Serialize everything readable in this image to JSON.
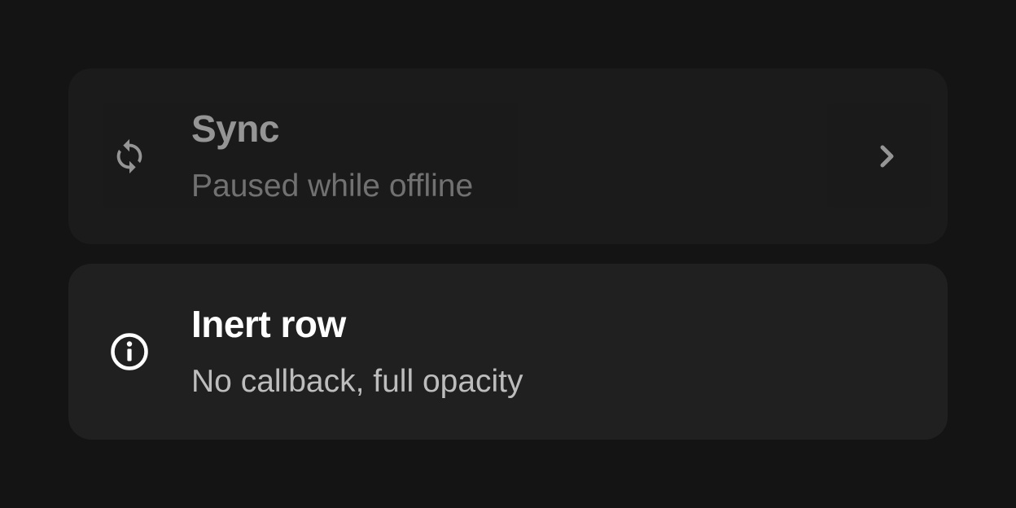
{
  "rows": [
    {
      "title": "Sync",
      "subtitle": "Paused while offline",
      "icon": "sync-icon",
      "trailing": "chevron-right-icon",
      "disabled": true
    },
    {
      "title": "Inert row",
      "subtitle": "No callback, full opacity",
      "icon": "info-icon",
      "disabled": false
    }
  ],
  "colors": {
    "background": "#141414",
    "row_background": "#202020",
    "title": "#ffffff",
    "subtitle": "#bdbdbd"
  }
}
